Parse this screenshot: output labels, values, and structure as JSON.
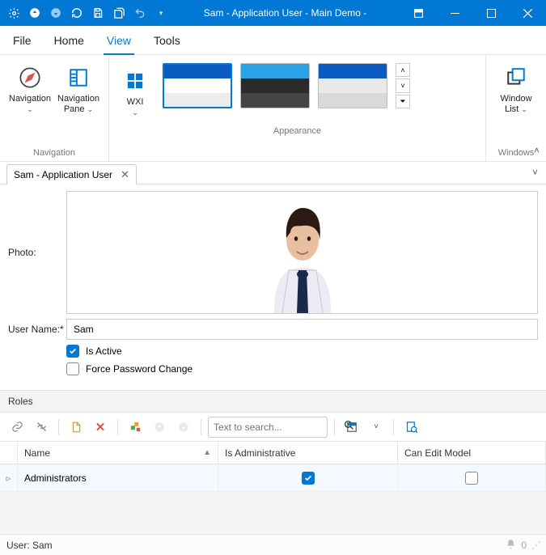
{
  "title_bar": {
    "title": "Sam - Application User - Main Demo -"
  },
  "menu": {
    "file": "File",
    "home": "Home",
    "view": "View",
    "tools": "Tools"
  },
  "ribbon": {
    "nav_group": "Navigation",
    "navigation": "Navigation",
    "navigation_pane": "Navigation\nPane",
    "wxi": "WXI",
    "appearance_group": "Appearance",
    "windows_group": "Windows",
    "window_list": "Window\nList"
  },
  "doc_tab": {
    "label": "Sam - Application User"
  },
  "form": {
    "photo_label": "Photo:",
    "username_label": "User Name:*",
    "username_value": "Sam",
    "is_active_label": "Is Active",
    "force_pw_label": "Force Password Change"
  },
  "roles": {
    "header": "Roles",
    "search_placeholder": "Text to search...",
    "columns": {
      "name": "Name",
      "is_admin": "Is Administrative",
      "can_edit": "Can Edit Model"
    },
    "rows": [
      {
        "name": "Administrators",
        "is_admin": true,
        "can_edit": false
      }
    ]
  },
  "status": {
    "user_label": "User: Sam",
    "notif_count": "0"
  }
}
